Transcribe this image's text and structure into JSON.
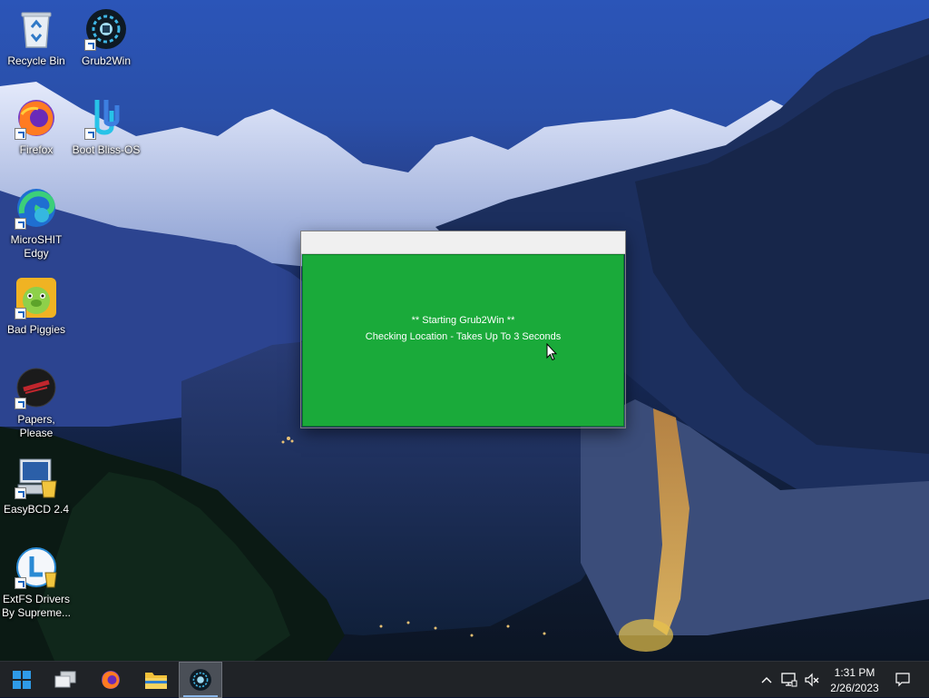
{
  "desktop": {
    "icons": [
      {
        "label": "Recycle Bin",
        "icon": "recycle-bin-icon"
      },
      {
        "label": "Grub2Win",
        "icon": "grub2win-icon"
      },
      {
        "label": "Firefox",
        "icon": "firefox-icon"
      },
      {
        "label": "Boot Bliss-OS",
        "icon": "bliss-os-icon"
      },
      {
        "label": "MicroSHIT Edgy",
        "icon": "edge-icon"
      },
      {
        "label": "Bad Piggies",
        "icon": "bad-piggies-icon"
      },
      {
        "label": "Papers, Please",
        "icon": "papers-please-icon"
      },
      {
        "label": "EasyBCD 2.4",
        "icon": "easybcd-icon"
      },
      {
        "label": "ExtFS Drivers By Supreme...",
        "icon": "extfs-drivers-icon"
      }
    ]
  },
  "dialog": {
    "line1": "** Starting Grub2Win **",
    "line2": "Checking Location - Takes Up To 3 Seconds",
    "background": "#1aaa3a"
  },
  "taskbar": {
    "items": [
      {
        "name": "start",
        "icon": "windows-start-icon"
      },
      {
        "name": "task-view",
        "icon": "task-view-icon"
      },
      {
        "name": "firefox",
        "icon": "firefox-icon"
      },
      {
        "name": "file-explorer",
        "icon": "folder-icon"
      },
      {
        "name": "grub2win",
        "icon": "grub2win-icon",
        "active": true
      }
    ],
    "tray": {
      "icons": [
        "chevron-up-icon",
        "network-icon",
        "volume-muted-icon"
      ],
      "time": "1:31 PM",
      "date": "2/26/2023",
      "notification_icon": "notification-icon"
    },
    "background": "#202327"
  }
}
